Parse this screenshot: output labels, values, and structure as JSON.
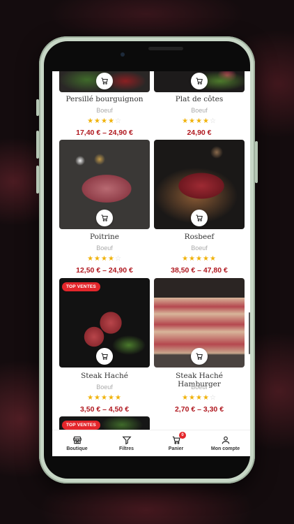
{
  "products": [
    {
      "name": "Persillé bourguignon",
      "category": "Boeuf",
      "rating": 4.5,
      "price": "17,40 € – 24,90 €"
    },
    {
      "name": "Plat de côtes",
      "category": "Boeuf",
      "rating": 4.5,
      "price": "24,90 €"
    },
    {
      "name": "Poitrine",
      "category": "Boeuf",
      "rating": 4,
      "price": "12,50 € – 24,90 €"
    },
    {
      "name": "Rosbeef",
      "category": "Boeuf",
      "rating": 5,
      "price": "38,50 € – 47,80 €"
    },
    {
      "name": "Steak Haché",
      "category": "Boeuf",
      "rating": 5,
      "price": "3,50 € – 4,50 €",
      "badge": "TOP VENTES"
    },
    {
      "name": "Steak Haché Hamburger",
      "category": "Boeuf",
      "rating": 4,
      "price": "2,70 € – 3,30 €"
    },
    {
      "badge": "TOP VENTES"
    }
  ],
  "nav": {
    "shop": "Boutique",
    "filters": "Filtres",
    "cart": "Panier",
    "cart_count": "0",
    "account": "Mon compte"
  },
  "colors": {
    "price": "#b0181f",
    "badge": "#e4262b",
    "star": "#f0b20a"
  }
}
